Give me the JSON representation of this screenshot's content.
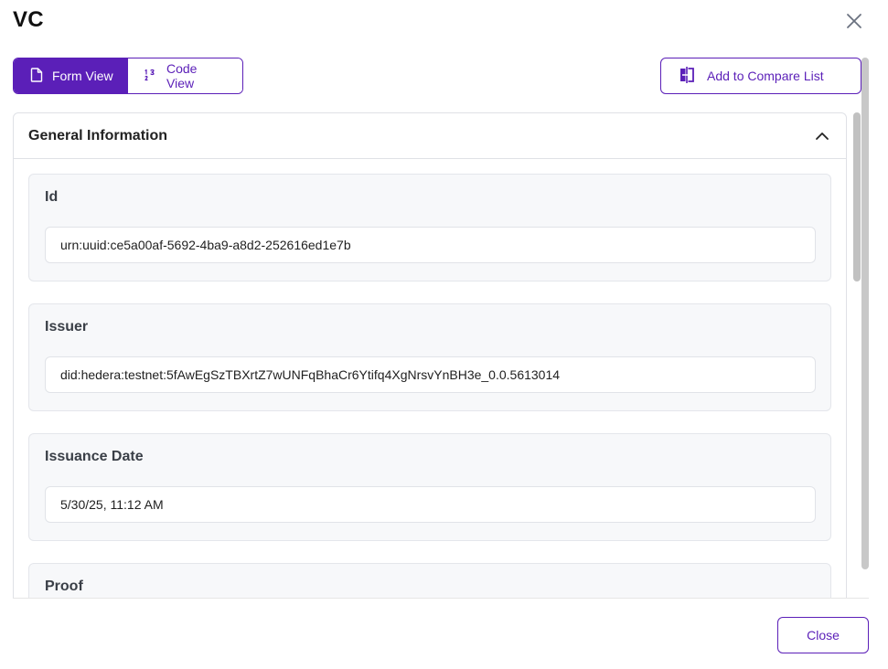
{
  "dialog": {
    "title": "VC"
  },
  "view_toggle": {
    "form_label": "Form View",
    "code_label": "Code View",
    "active": "Form View"
  },
  "compare_button": {
    "label": "Add to Compare List"
  },
  "section": {
    "title": "General Information",
    "expanded": true
  },
  "fields": [
    {
      "label": "Id",
      "value": "urn:uuid:ce5a00af-5692-4ba9-a8d2-252616ed1e7b"
    },
    {
      "label": "Issuer",
      "value": "did:hedera:testnet:5fAwEgSzTBXrtZ7wUNFqBhaCr6Ytifq4XgNrsvYnBH3e_0.0.5613014"
    },
    {
      "label": "Issuance Date",
      "value": "5/30/25, 11:12 AM"
    },
    {
      "label": "Proof",
      "value": ""
    }
  ],
  "footer": {
    "close_label": "Close"
  },
  "colors": {
    "accent": "#5b1fb8",
    "card_bg": "#f7f8fa",
    "border": "#dfe1e6"
  }
}
